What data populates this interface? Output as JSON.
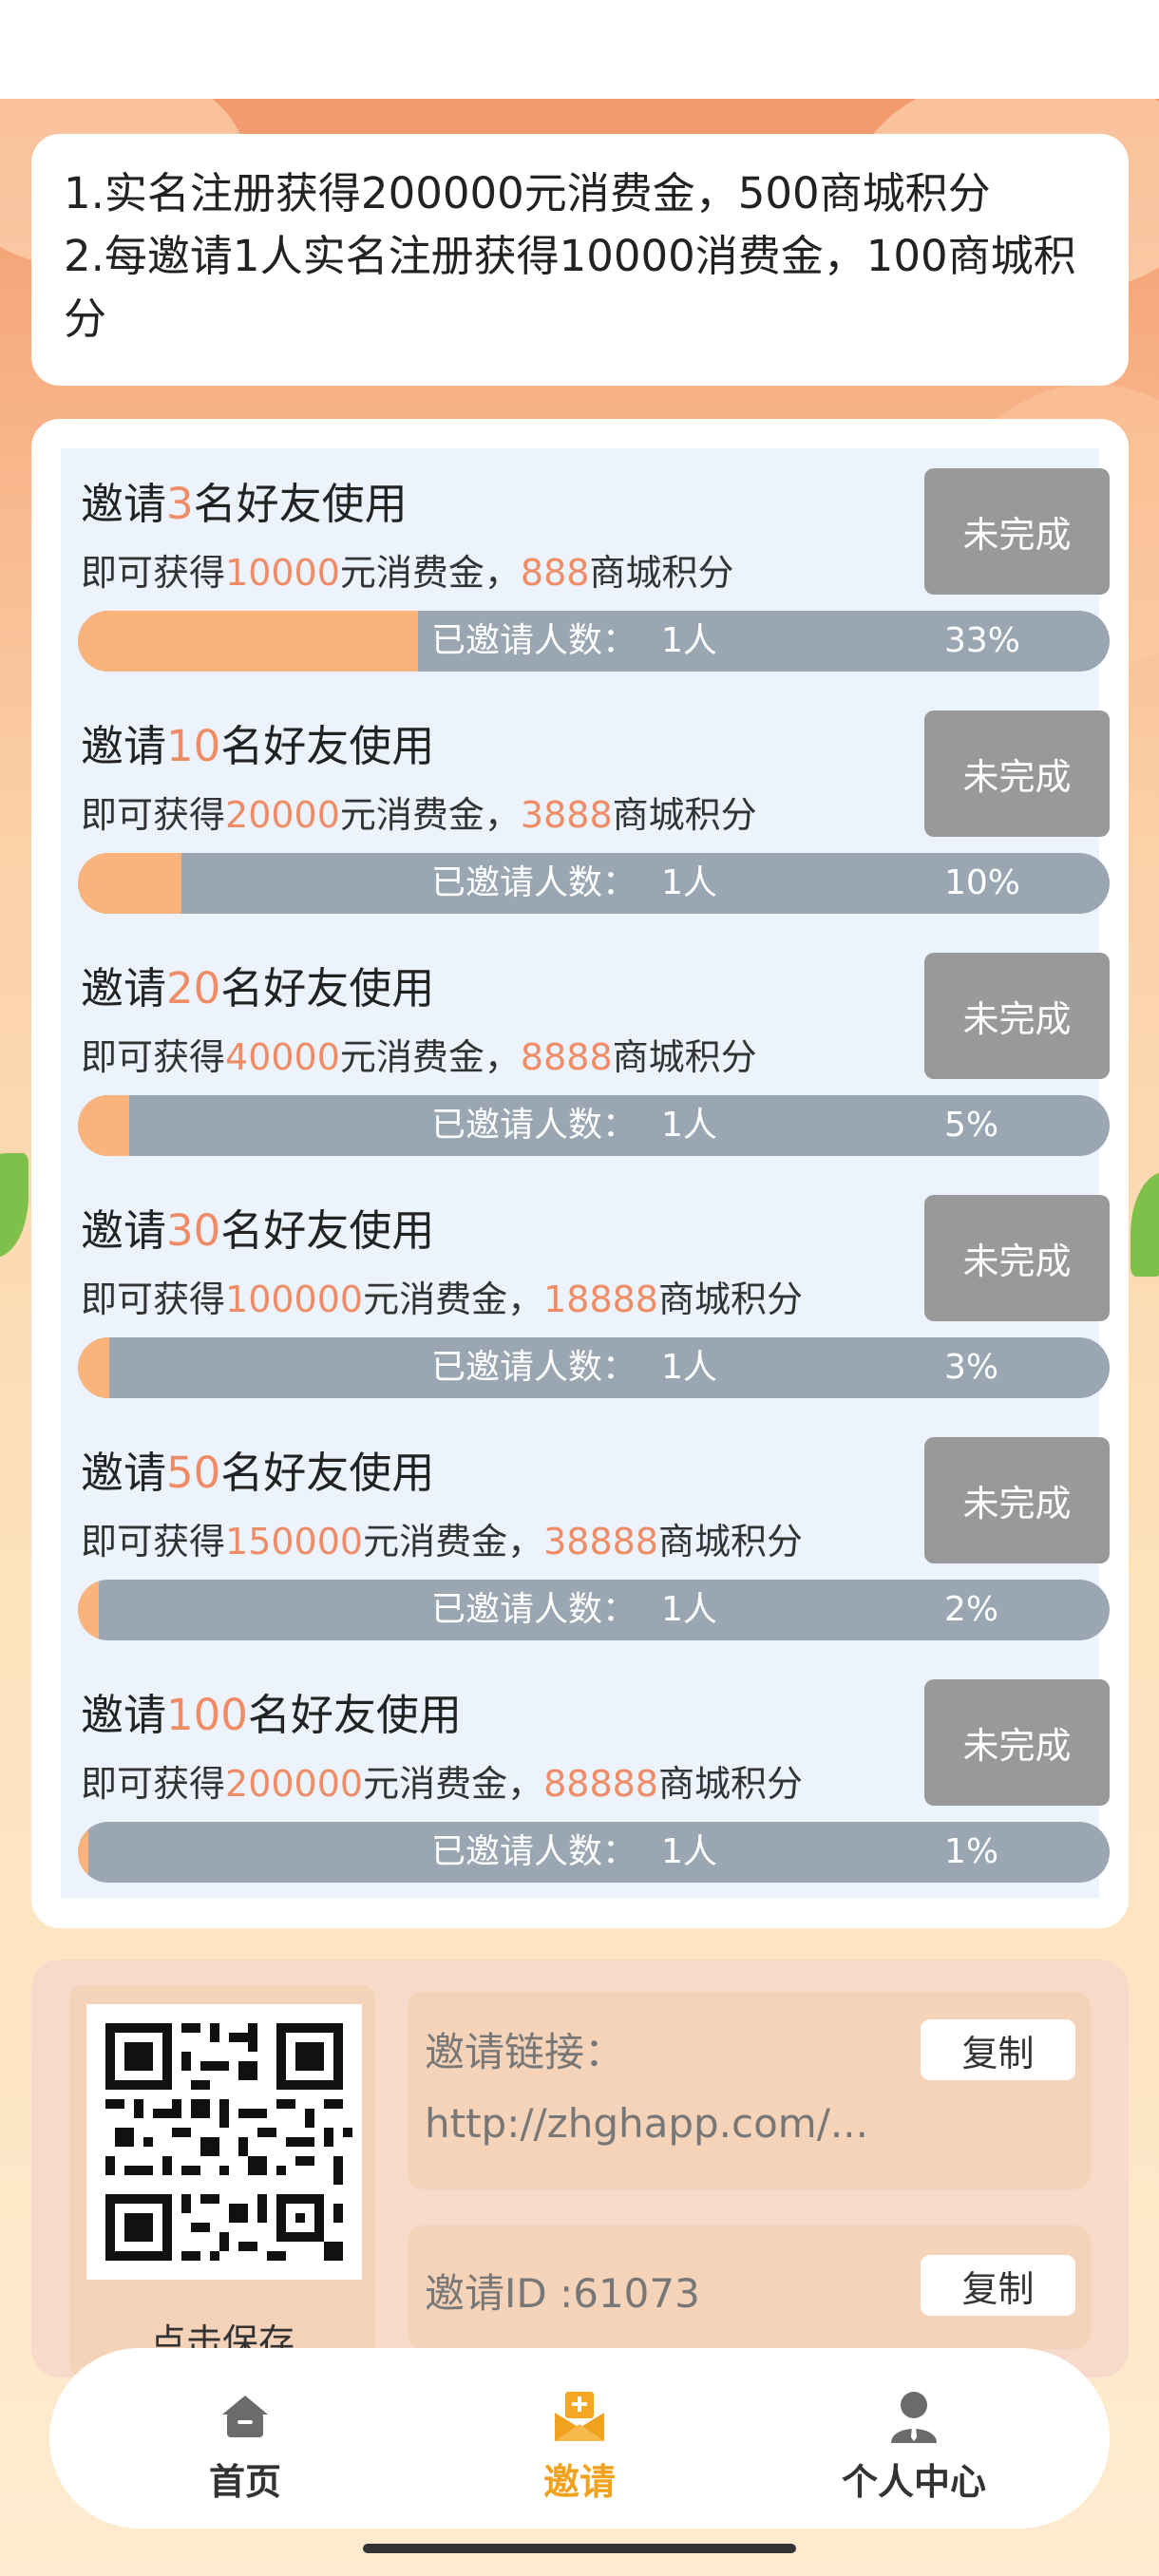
{
  "rules": {
    "line1": "1.实名注册获得200000元消费金，500商城积分",
    "line2": "2.每邀请1人实名注册获得10000消费金，100商城积分"
  },
  "tasks": [
    {
      "title_pre": "邀请",
      "count": "3",
      "title_post": "名好友使用",
      "reward_pre": "即可获得",
      "money": "10000",
      "reward_mid": "元消费金，",
      "points": "888",
      "reward_post": "商城积分",
      "status": "未完成",
      "invited_label": "已邀请人数：",
      "invited": "1人",
      "percent_text": "33%",
      "progress": 0.33
    },
    {
      "title_pre": "邀请",
      "count": "10",
      "title_post": "名好友使用",
      "reward_pre": "即可获得",
      "money": "20000",
      "reward_mid": "元消费金，",
      "points": "3888",
      "reward_post": "商城积分",
      "status": "未完成",
      "invited_label": "已邀请人数：",
      "invited": "1人",
      "percent_text": "10%",
      "progress": 0.1
    },
    {
      "title_pre": "邀请",
      "count": "20",
      "title_post": "名好友使用",
      "reward_pre": "即可获得",
      "money": "40000",
      "reward_mid": "元消费金，",
      "points": "8888",
      "reward_post": "商城积分",
      "status": "未完成",
      "invited_label": "已邀请人数：",
      "invited": "1人",
      "percent_text": "5%",
      "progress": 0.05
    },
    {
      "title_pre": "邀请",
      "count": "30",
      "title_post": "名好友使用",
      "reward_pre": "即可获得",
      "money": "100000",
      "reward_mid": "元消费金，",
      "points": "18888",
      "reward_post": "商城积分",
      "status": "未完成",
      "invited_label": "已邀请人数：",
      "invited": "1人",
      "percent_text": "3%",
      "progress": 0.03
    },
    {
      "title_pre": "邀请",
      "count": "50",
      "title_post": "名好友使用",
      "reward_pre": "即可获得",
      "money": "150000",
      "reward_mid": "元消费金，",
      "points": "38888",
      "reward_post": "商城积分",
      "status": "未完成",
      "invited_label": "已邀请人数：",
      "invited": "1人",
      "percent_text": "2%",
      "progress": 0.02
    },
    {
      "title_pre": "邀请",
      "count": "100",
      "title_post": "名好友使用",
      "reward_pre": "即可获得",
      "money": "200000",
      "reward_mid": "元消费金，",
      "points": "88888",
      "reward_post": "商城积分",
      "status": "未完成",
      "invited_label": "已邀请人数：",
      "invited": "1人",
      "percent_text": "1%",
      "progress": 0.01
    }
  ],
  "invite": {
    "qr_caption": "点击保存",
    "link_label": "邀请链接：",
    "link_value": "http://zhghapp.com/...",
    "copy_label": "复制",
    "id_label": "邀请ID :61073"
  },
  "nav": {
    "items": [
      {
        "label": "首页",
        "icon": "home-icon",
        "active": false
      },
      {
        "label": "邀请",
        "icon": "invite-icon",
        "active": true
      },
      {
        "label": "个人中心",
        "icon": "person-icon",
        "active": false
      }
    ]
  },
  "colors": {
    "accent": "#f08c65",
    "progress_fill": "#fbb37c",
    "progress_track": "#9aa6b2",
    "button_gray": "#999999",
    "nav_active": "#f0a21e"
  }
}
